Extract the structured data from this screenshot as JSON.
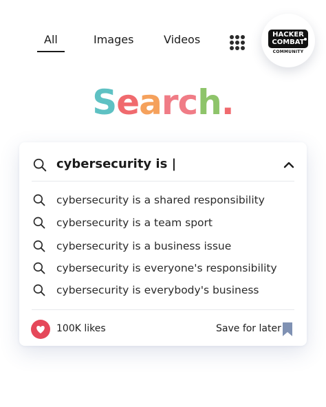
{
  "tabs": [
    {
      "label": "All",
      "active": true
    },
    {
      "label": "Images",
      "active": false
    },
    {
      "label": "Videos",
      "active": false
    }
  ],
  "icons": {
    "apps": "apps-grid-icon",
    "search": "search-icon",
    "collapse": "chevron-up-icon",
    "like": "heart-icon",
    "bookmark": "bookmark-icon"
  },
  "logo": {
    "line1": "HACKER",
    "line2": "COMBAT",
    "subtitle": "COMMUNITY"
  },
  "brand": {
    "letters": [
      "S",
      "e",
      "a",
      "r",
      "c",
      "h",
      "."
    ],
    "colors": [
      "#5ec1c3",
      "#f06a6e",
      "#f5a15c",
      "#f07c86",
      "#f07c86",
      "#8ec46a",
      "#f06a6e"
    ]
  },
  "search": {
    "query": "cybersecurity is |"
  },
  "suggestions": [
    "cybersecurity is a shared responsibility",
    "cybersecurity is a team sport",
    "cybersecurity is a business issue",
    "cybersecurity is everyone's responsibility",
    "cybersecurity is everybody's business"
  ],
  "footer": {
    "likes": "100K  likes",
    "save_label": "Save for later"
  },
  "colors": {
    "like_heart": "#e5485a",
    "bookmark": "#7f91b3"
  }
}
